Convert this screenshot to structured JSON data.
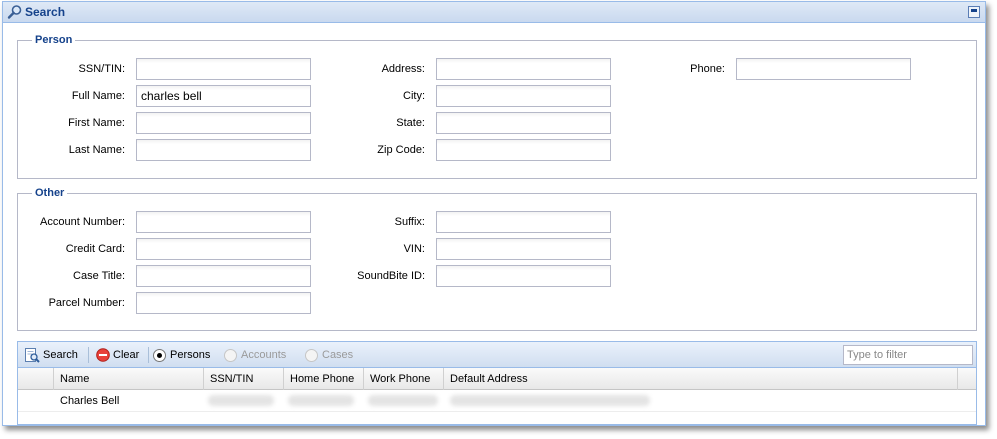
{
  "panel": {
    "title": "Search"
  },
  "person": {
    "legend": "Person",
    "fields": [
      {
        "label": "SSN/TIN:",
        "value": ""
      },
      {
        "label": "Full Name:",
        "value": "charles bell"
      },
      {
        "label": "First Name:",
        "value": ""
      },
      {
        "label": "Last Name:",
        "value": ""
      },
      {
        "label": "Address:",
        "value": ""
      },
      {
        "label": "City:",
        "value": ""
      },
      {
        "label": "State:",
        "value": ""
      },
      {
        "label": "Zip Code:",
        "value": ""
      },
      {
        "label": "Phone:",
        "value": ""
      }
    ]
  },
  "other": {
    "legend": "Other",
    "fields": [
      {
        "label": "Account Number:",
        "value": ""
      },
      {
        "label": "Credit Card:",
        "value": ""
      },
      {
        "label": "Case Title:",
        "value": ""
      },
      {
        "label": "Parcel Number:",
        "value": ""
      },
      {
        "label": "Suffix:",
        "value": ""
      },
      {
        "label": "VIN:",
        "value": ""
      },
      {
        "label": "SoundBite ID:",
        "value": ""
      }
    ]
  },
  "toolbar": {
    "search_label": "Search",
    "clear_label": "Clear",
    "persons_label": "Persons",
    "accounts_label": "Accounts",
    "cases_label": "Cases",
    "selected_scope": "Persons",
    "filter_placeholder": "Type to filter"
  },
  "grid": {
    "columns": [
      "Name",
      "SSN/TIN",
      "Home Phone",
      "Work Phone",
      "Default Address"
    ],
    "rows": [
      {
        "name": "Charles Bell"
      }
    ]
  },
  "colors": {
    "accent": "#15428b",
    "border": "#99bbe8"
  }
}
